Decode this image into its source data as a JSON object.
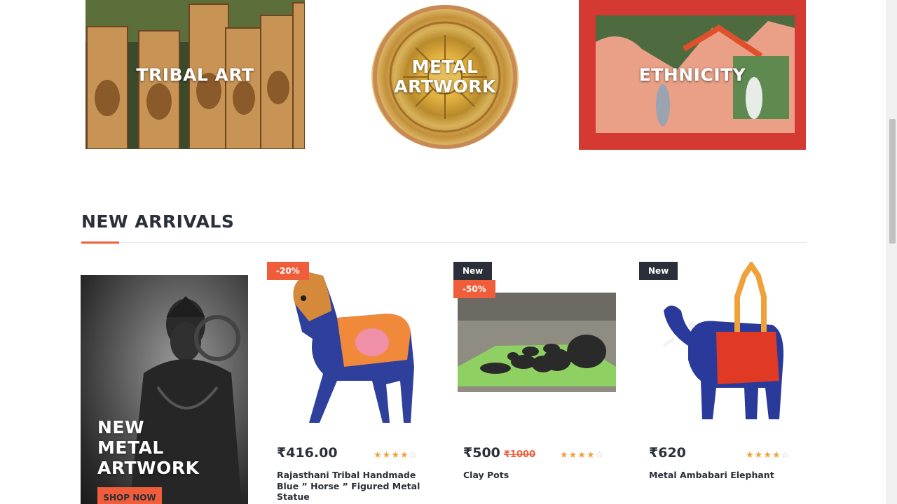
{
  "categories": [
    {
      "label": "TRIBAL ART"
    },
    {
      "label": "METAL ARTWORK",
      "lines": [
        "METAL",
        "ARTWORK"
      ]
    },
    {
      "label": "ETHNICITY"
    }
  ],
  "new_arrivals": {
    "title": "NEW ARRIVALS",
    "promo": {
      "lines": [
        "NEW",
        "METAL",
        "ARTWORK"
      ],
      "button_label": "SHOP NOW"
    },
    "products": [
      {
        "badge_discount": "-20%",
        "price": "₹416.00",
        "rating": 4,
        "name": "Rajasthani Tribal Handmade Blue ” Horse ” Figured Metal Statue"
      },
      {
        "badge_new": "New",
        "badge_discount": "-50%",
        "price": "₹500",
        "old_price": "₹1000",
        "rating": 4,
        "name": "Clay Pots"
      },
      {
        "badge_new": "New",
        "price": "₹620",
        "rating": 4,
        "name": "Metal Ambabari Elephant"
      }
    ]
  },
  "colors": {
    "accent": "#f05d3b",
    "dark": "#2b2f3a",
    "star": "#f2a03a"
  }
}
